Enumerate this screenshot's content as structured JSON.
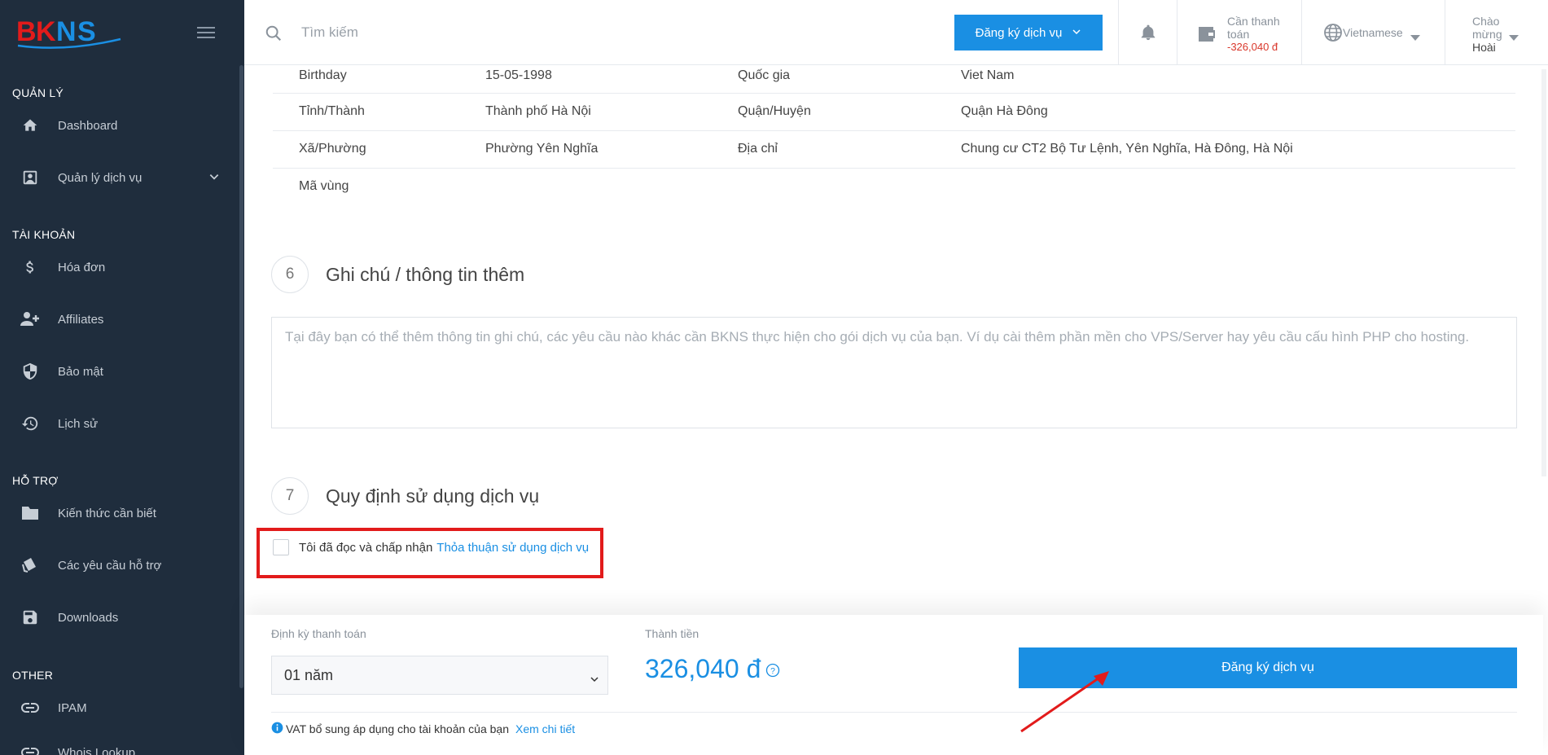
{
  "brand": {
    "logo_text": "BKNS",
    "colors": {
      "red": "#e21b1b",
      "blue": "#1a8fe3",
      "sidebar": "#1f2d3d"
    }
  },
  "sidebar": {
    "sections": [
      {
        "title": "QUẢN LÝ"
      },
      {
        "title": "TÀI KHOẢN"
      },
      {
        "title": "HỖ TRỢ"
      },
      {
        "title": "OTHER"
      }
    ],
    "items": [
      {
        "label": "Dashboard",
        "icon": "home-icon"
      },
      {
        "label": "Quản lý dịch vụ",
        "icon": "account-box-icon"
      },
      {
        "label": "Hóa đơn",
        "icon": "dollar-icon"
      },
      {
        "label": "Affiliates",
        "icon": "add-user-icon"
      },
      {
        "label": "Bảo mật",
        "icon": "shield-icon"
      },
      {
        "label": "Lịch sử",
        "icon": "history-icon"
      },
      {
        "label": "Kiến thức cần biết",
        "icon": "folder-icon"
      },
      {
        "label": "Các yêu cầu hỗ trợ",
        "icon": "tickets-icon"
      },
      {
        "label": "Downloads",
        "icon": "save-icon"
      },
      {
        "label": "IPAM",
        "icon": "link-icon"
      },
      {
        "label": "Whois Lookup",
        "icon": "link-icon"
      }
    ]
  },
  "topbar": {
    "search_placeholder": "Tìm kiếm",
    "register_label": "Đăng ký dịch vụ",
    "due_label": "Cần thanh toán",
    "due_value": "-326,040 đ",
    "language": "Vietnamese",
    "greeting": "Chào mừng",
    "user_name": "Hoài"
  },
  "info_rows": [
    [
      "Birthday",
      "15-05-1998",
      "Quốc gia",
      "Viet Nam"
    ],
    [
      "Tỉnh/Thành",
      "Thành phố Hà Nội",
      "Quận/Huyện",
      "Quận Hà Đông"
    ],
    [
      "Xã/Phường",
      "Phường Yên Nghĩa",
      "Địa chỉ",
      "Chung cư CT2 Bộ Tư Lệnh, Yên Nghĩa, Hà Đông, Hà Nội"
    ],
    [
      "Mã vùng",
      "",
      "",
      ""
    ]
  ],
  "steps": {
    "notes": {
      "number": "6",
      "title": "Ghi chú / thông tin thêm",
      "placeholder": "Tại đây bạn có thể thêm thông tin ghi chú, các yêu cầu nào khác cần BKNS thực hiện cho gói dịch vụ của bạn. Ví dụ cài thêm phần mền cho VPS/Server hay yêu cầu cấu hình PHP cho hosting."
    },
    "terms": {
      "number": "7",
      "title": "Quy định sử dụng dịch vụ",
      "accept_text": "Tôi đã đọc và chấp nhận",
      "link_text": "Thỏa thuận sử dụng dịch vụ",
      "checked": false
    }
  },
  "footer": {
    "period_label": "Định kỳ thanh toán",
    "period_value": "01 năm",
    "total_label": "Thành tiền",
    "total_value": "326,040 đ",
    "register_label": "Đăng ký dịch vụ",
    "vat_text": "VAT bổ sung áp dụng cho tài khoản của bạn",
    "vat_link": "Xem chi tiết"
  }
}
